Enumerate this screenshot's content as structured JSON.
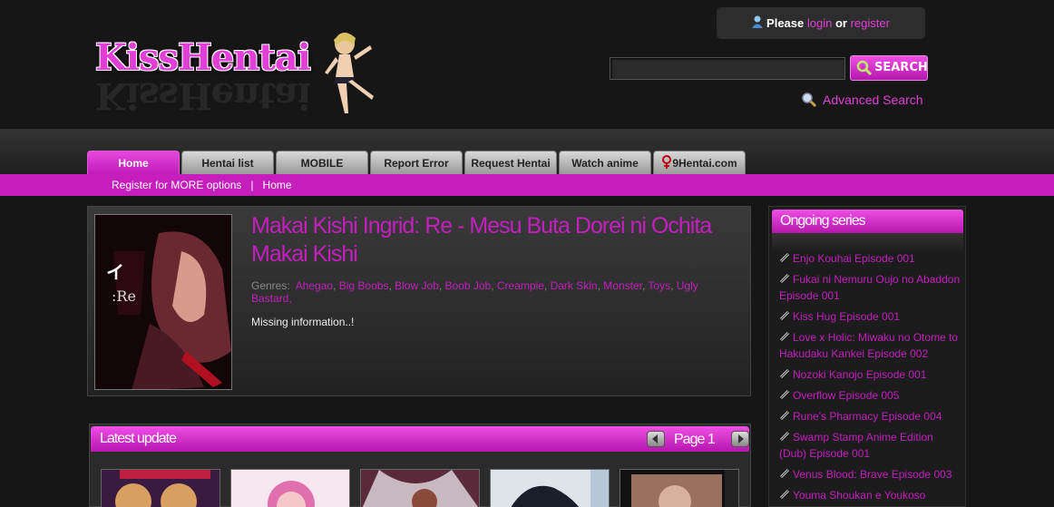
{
  "header": {
    "logo_text": "KissHentai",
    "login": {
      "prefix": "Please",
      "login_label": "login",
      "or_label": "or",
      "register_label": "register"
    },
    "search": {
      "placeholder": "",
      "button_label": "SEARCH"
    },
    "advanced_search_label": "Advanced Search"
  },
  "nav": {
    "tabs": [
      {
        "label": "Home",
        "active": true
      },
      {
        "label": "Hentai list"
      },
      {
        "label": "MOBILE"
      },
      {
        "label": "Report Error"
      },
      {
        "label": "Request Hentai"
      },
      {
        "label": "Watch anime"
      },
      {
        "label": "9Hentai.com"
      }
    ],
    "subnav": {
      "register_label": "Register for MORE options",
      "separator": "|",
      "home_label": "Home"
    }
  },
  "detail": {
    "title": "Makai Kishi Ingrid: Re - Mesu Buta Dorei ni Ochita Makai Kishi",
    "genres_label": "Genres:",
    "genres": [
      "Ahegao",
      "Big Boobs",
      "Blow Job",
      "Boob Job",
      "Creampie",
      "Dark Skin",
      "Monster",
      "Toys",
      "Ugly Bastard"
    ],
    "info": "Missing information..!"
  },
  "latest": {
    "title": "Latest update",
    "page_label": "Page 1"
  },
  "sidebar": {
    "title": "Ongoing series",
    "items": [
      "Enjo Kouhai Episode 001",
      "Fukai ni Nemuru Oujo no Abaddon Episode 001",
      "Kiss Hug Episode 001",
      "Love x Holic: Miwaku no Otome to Hakudaku Kankei Episode 002",
      "Nozoki Kanojo Episode 001",
      "Overflow Episode 005",
      "Rune's Pharmacy Episode 004",
      "Swamp Stamp Anime Edition (Dub) Episode 001",
      "Venus Blood: Brave Episode 003",
      "Youma Shoukan e Youkoso"
    ]
  },
  "colors": {
    "accent": "#c41fbe",
    "accent_light": "#e23fd7",
    "background": "#161616"
  }
}
